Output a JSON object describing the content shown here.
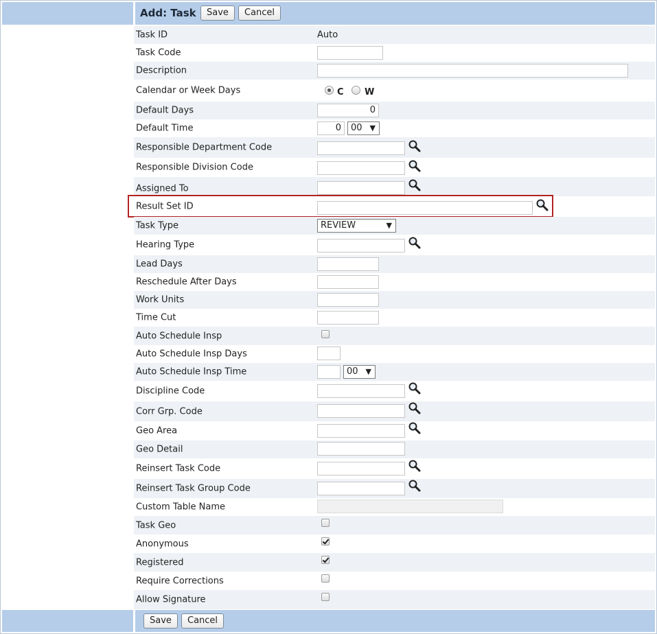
{
  "header": {
    "title": "Add: Task",
    "save": "Save",
    "cancel": "Cancel"
  },
  "footer": {
    "save": "Save",
    "cancel": "Cancel"
  },
  "fields": {
    "task_id": {
      "label": "Task ID",
      "value": "Auto"
    },
    "task_code": {
      "label": "Task Code",
      "value": ""
    },
    "description": {
      "label": "Description",
      "value": ""
    },
    "calendar": {
      "label": "Calendar or Week Days",
      "opt_c": "C",
      "opt_w": "W",
      "selected": "C"
    },
    "default_days": {
      "label": "Default Days",
      "value": "0"
    },
    "default_time": {
      "label": "Default Time",
      "hours": "0",
      "minutes": "00"
    },
    "resp_dept": {
      "label": "Responsible Department Code",
      "value": ""
    },
    "resp_div": {
      "label": "Responsible Division Code",
      "value": ""
    },
    "assigned_to": {
      "label": "Assigned To",
      "value": ""
    },
    "result_set": {
      "label": "Result Set ID",
      "value": ""
    },
    "task_type": {
      "label": "Task Type",
      "value": "REVIEW"
    },
    "hearing_type": {
      "label": "Hearing Type",
      "value": ""
    },
    "lead_days": {
      "label": "Lead Days",
      "value": ""
    },
    "reschedule": {
      "label": "Reschedule After Days",
      "value": ""
    },
    "work_units": {
      "label": "Work Units",
      "value": ""
    },
    "time_cut": {
      "label": "Time Cut",
      "value": ""
    },
    "auto_sched": {
      "label": "Auto Schedule Insp",
      "checked": false
    },
    "auto_sched_days": {
      "label": "Auto Schedule Insp Days",
      "value": ""
    },
    "auto_sched_time": {
      "label": "Auto Schedule Insp Time",
      "hours": "",
      "minutes": "00"
    },
    "discipline": {
      "label": "Discipline Code",
      "value": ""
    },
    "corr_grp": {
      "label": "Corr Grp. Code",
      "value": ""
    },
    "geo_area": {
      "label": "Geo Area",
      "value": ""
    },
    "geo_detail": {
      "label": "Geo Detail",
      "value": ""
    },
    "reinsert_task": {
      "label": "Reinsert Task Code",
      "value": ""
    },
    "reinsert_group": {
      "label": "Reinsert Task Group Code",
      "value": ""
    },
    "custom_table": {
      "label": "Custom Table Name",
      "value": ""
    },
    "task_geo": {
      "label": "Task Geo",
      "checked": false
    },
    "anonymous": {
      "label": "Anonymous",
      "checked": true
    },
    "registered": {
      "label": "Registered",
      "checked": true
    },
    "require_corr": {
      "label": "Require Corrections",
      "checked": false
    },
    "allow_sig": {
      "label": "Allow Signature",
      "checked": false
    }
  },
  "icons": {
    "lookup": "magnifier-icon",
    "dropdown": "triangle-down-icon"
  },
  "colors": {
    "header_bar": "#b5cde9",
    "alt_row": "#eef1f5",
    "highlight": "#b22222"
  }
}
